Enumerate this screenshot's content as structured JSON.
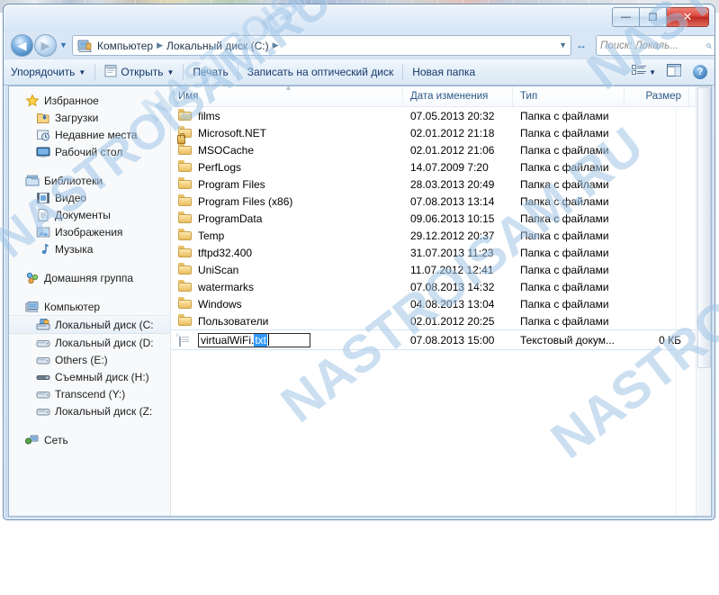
{
  "window": {
    "title": "",
    "controls": {
      "minimize": "—",
      "maximize": "❐",
      "close": "✕"
    }
  },
  "address": {
    "back_arrow": "◀",
    "forward_arrow": "▶",
    "history_caret": "▼",
    "computer_icon": "computer-icon",
    "crumbs": [
      "Компьютер",
      "Локальный диск (C:)"
    ],
    "separator": "▶",
    "dropdown_caret": "▼",
    "refresh_glyph": "↔",
    "search_placeholder": "Поиск: Локаль...",
    "search_glyph": "⌕"
  },
  "toolbar": {
    "organize": "Упорядочить",
    "open": "Открыть",
    "print": "Печать",
    "burn": "Записать на оптический диск",
    "new_folder": "Новая папка",
    "caret": "▼",
    "view_icon": "view-list-icon",
    "preview_icon": "preview-pane-icon",
    "help_icon": "help-icon",
    "help_glyph": "?"
  },
  "sidebar": {
    "groups": [
      {
        "header": {
          "label": "Избранное",
          "icon": "star-icon"
        },
        "items": [
          {
            "label": "Загрузки",
            "icon": "downloads-icon"
          },
          {
            "label": "Недавние места",
            "icon": "recent-places-icon"
          },
          {
            "label": "Рабочий стол",
            "icon": "desktop-icon"
          }
        ]
      },
      {
        "header": {
          "label": "Библиотеки",
          "icon": "libraries-icon"
        },
        "items": [
          {
            "label": "Видео",
            "icon": "video-icon"
          },
          {
            "label": "Документы",
            "icon": "documents-icon"
          },
          {
            "label": "Изображения",
            "icon": "pictures-icon"
          },
          {
            "label": "Музыка",
            "icon": "music-icon"
          }
        ]
      },
      {
        "header": {
          "label": "Домашняя группа",
          "icon": "homegroup-icon"
        },
        "items": []
      },
      {
        "header": {
          "label": "Компьютер",
          "icon": "computer-icon"
        },
        "items": [
          {
            "label": "Локальный диск (C:",
            "icon": "system-drive-icon",
            "selected": true
          },
          {
            "label": "Локальный диск (D:",
            "icon": "drive-icon"
          },
          {
            "label": "Others (E:)",
            "icon": "drive-icon"
          },
          {
            "label": "Съемный диск (H:)",
            "icon": "removable-drive-icon"
          },
          {
            "label": "Transcend (Y:)",
            "icon": "drive-icon"
          },
          {
            "label": "Локальный диск (Z:",
            "icon": "drive-icon"
          }
        ]
      },
      {
        "header": {
          "label": "Сеть",
          "icon": "network-icon"
        },
        "items": []
      }
    ]
  },
  "file_list": {
    "columns": [
      "Имя",
      "Дата изменения",
      "Тип",
      "Размер"
    ],
    "sort_indicator": "▲",
    "folder_type": "Папка с файлами",
    "rows": [
      {
        "name": "films",
        "date": "07.05.2013 20:32",
        "type": "Папка с файлами",
        "size": "",
        "icon": "folder-icon"
      },
      {
        "name": "Microsoft.NET",
        "date": "02.01.2012 21:18",
        "type": "Папка с файлами",
        "size": "",
        "icon": "folder-icon"
      },
      {
        "name": "MSOCache",
        "date": "02.01.2012 21:06",
        "type": "Папка с файлами",
        "size": "",
        "icon": "folder-locked-icon"
      },
      {
        "name": "PerfLogs",
        "date": "14.07.2009 7:20",
        "type": "Папка с файлами",
        "size": "",
        "icon": "folder-icon"
      },
      {
        "name": "Program Files",
        "date": "28.03.2013 20:49",
        "type": "Папка с файлами",
        "size": "",
        "icon": "folder-icon"
      },
      {
        "name": "Program Files (x86)",
        "date": "07.08.2013 13:14",
        "type": "Папка с файлами",
        "size": "",
        "icon": "folder-icon"
      },
      {
        "name": "ProgramData",
        "date": "09.06.2013 10:15",
        "type": "Папка с файлами",
        "size": "",
        "icon": "folder-icon"
      },
      {
        "name": "Temp",
        "date": "29.12.2012 20:37",
        "type": "Папка с файлами",
        "size": "",
        "icon": "folder-icon"
      },
      {
        "name": "tftpd32.400",
        "date": "31.07.2013 11:23",
        "type": "Папка с файлами",
        "size": "",
        "icon": "folder-icon"
      },
      {
        "name": "UniScan",
        "date": "11.07.2012 12:41",
        "type": "Папка с файлами",
        "size": "",
        "icon": "folder-icon"
      },
      {
        "name": "watermarks",
        "date": "07.08.2013 14:32",
        "type": "Папка с файлами",
        "size": "",
        "icon": "folder-icon"
      },
      {
        "name": "Windows",
        "date": "04.08.2013 13:04",
        "type": "Папка с файлами",
        "size": "",
        "icon": "folder-icon"
      },
      {
        "name": "Пользователи",
        "date": "02.01.2012 20:25",
        "type": "Папка с файлами",
        "size": "",
        "icon": "folder-icon"
      }
    ],
    "editing_row": {
      "name_base": "virtualWiFi.",
      "name_selected": "txt",
      "date": "07.08.2013 15:00",
      "type": "Текстовый докум...",
      "size": "0 КБ",
      "icon": "text-document-icon"
    }
  },
  "watermark": {
    "text": "NASTROISAM.RU",
    "color": "#9dc3e6"
  }
}
